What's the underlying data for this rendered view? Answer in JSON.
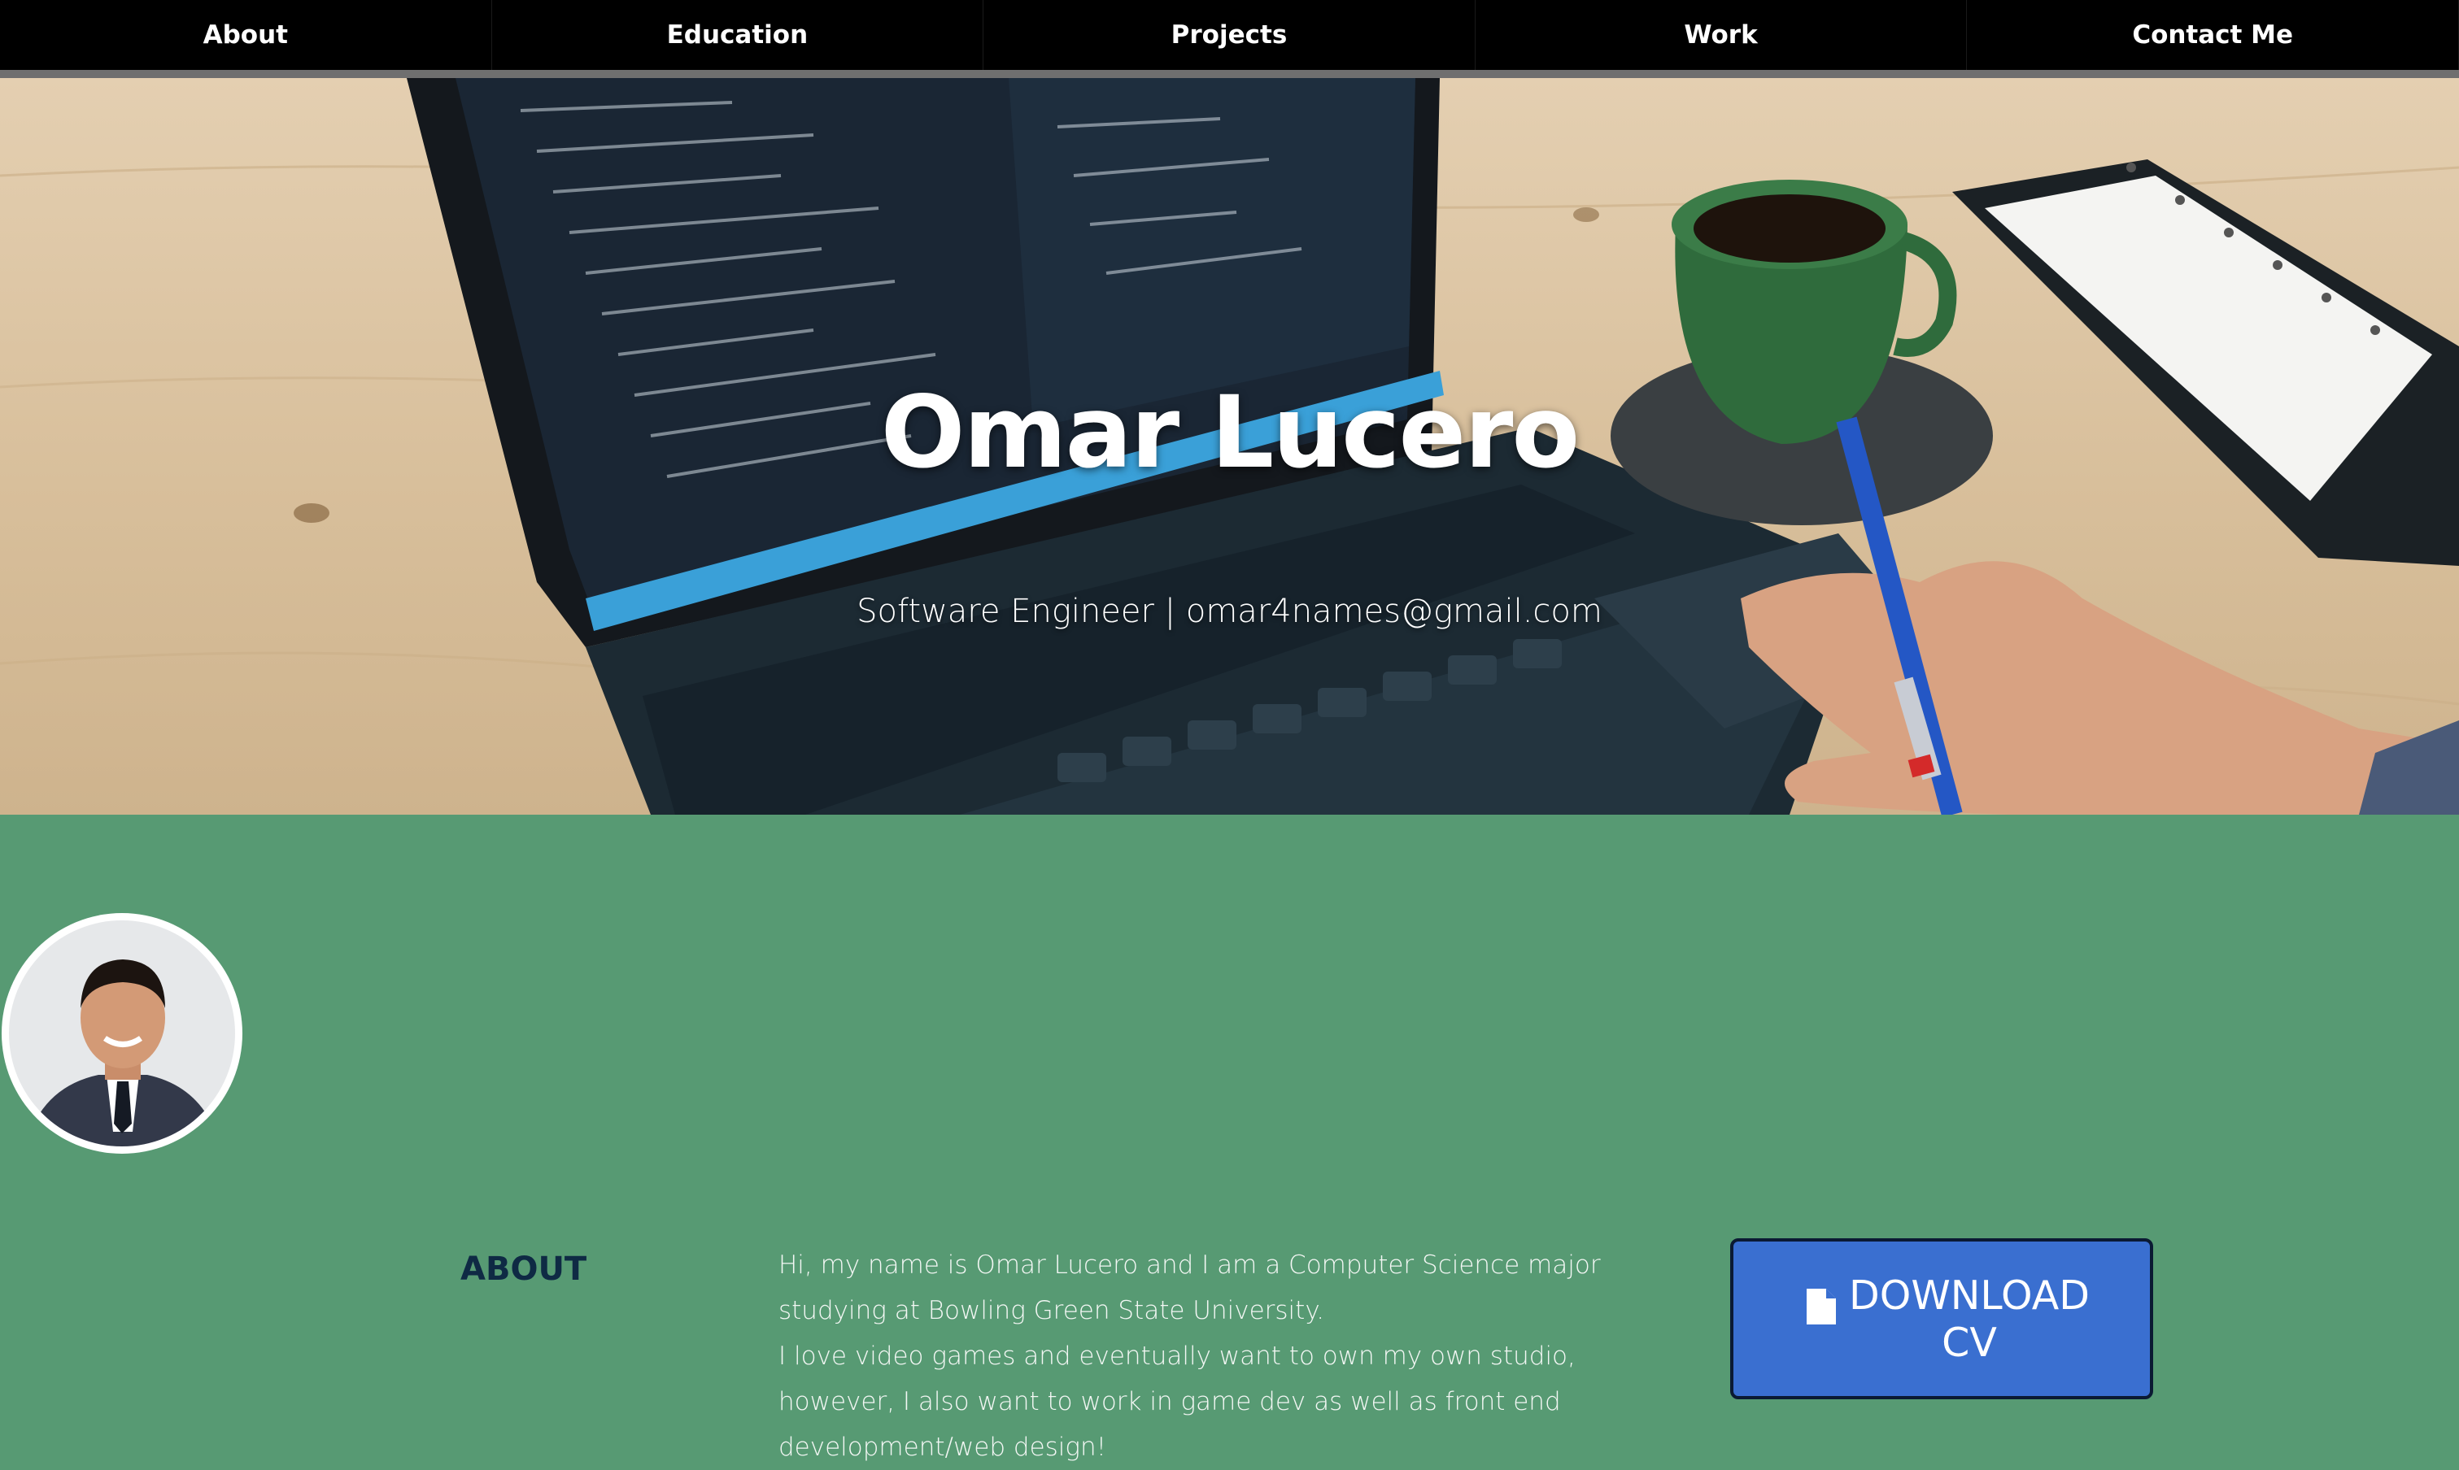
{
  "nav": {
    "items": [
      {
        "label": "About"
      },
      {
        "label": "Education"
      },
      {
        "label": "Projects"
      },
      {
        "label": "Work"
      },
      {
        "label": "Contact Me"
      }
    ]
  },
  "hero": {
    "name": "Omar Lucero",
    "subtitle": "Software Engineer | omar4names@gmail.com"
  },
  "about": {
    "heading": "ABOUT",
    "paragraphs": [
      "Hi, my name is Omar Lucero and I am a Computer Science major studying at Bowling Green State University.",
      "I love video games and eventually want to own my own studio, however, I also want to work in game dev as well as front end development/web design!"
    ],
    "cv_button_label": "DOWNLOAD CV"
  },
  "colors": {
    "nav_bg": "#000000",
    "section_bg": "#579a73",
    "button_bg": "#3a6fd0",
    "heading": "#0f2a44"
  }
}
